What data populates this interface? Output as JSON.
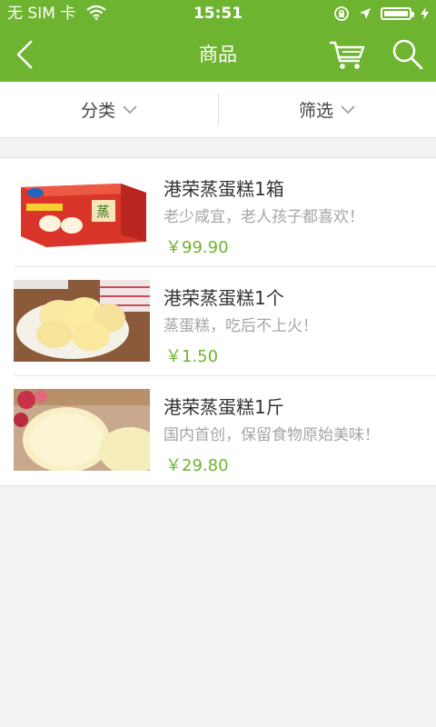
{
  "status_bar": {
    "carrier": "无 SIM 卡",
    "time": "15:51"
  },
  "nav": {
    "title": "商品",
    "back_icon": "chevron-left-icon",
    "cart_icon": "cart-icon",
    "search_icon": "search-icon"
  },
  "filters": [
    {
      "label": "分类",
      "icon": "chevron-down-icon"
    },
    {
      "label": "筛选",
      "icon": "chevron-down-icon"
    }
  ],
  "products": [
    {
      "name": "港荣蒸蛋糕1箱",
      "desc": "老少咸宜，老人孩子都喜欢！",
      "price": "￥99.90",
      "image": "cake-box-image"
    },
    {
      "name": "港荣蒸蛋糕1个",
      "desc": "蒸蛋糕，吃后不上火！",
      "price": "￥1.50",
      "image": "cake-plate-image"
    },
    {
      "name": "港荣蒸蛋糕1斤",
      "desc": "国内首创，保留食物原始美味！",
      "price": "￥29.80",
      "image": "cake-closeup-image"
    }
  ],
  "colors": {
    "brand": "#6fb430",
    "background": "#f3f3f3"
  }
}
